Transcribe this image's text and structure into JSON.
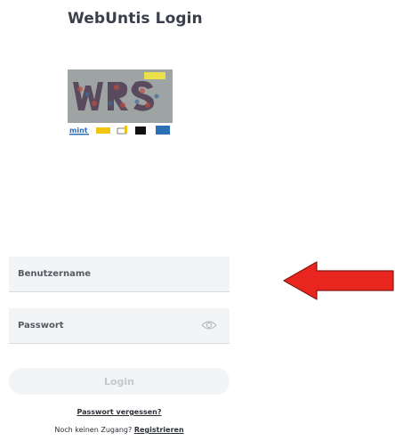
{
  "page": {
    "title": "WebUntis Login"
  },
  "logo": {
    "badge_text": "mint",
    "sponsor_text": "MINT",
    "colors": {
      "photo_bg": "#9aa0a4",
      "badge": "#e9e04a",
      "footer_blue": "#2c6fb5",
      "footer_yellow": "#f1c40f"
    }
  },
  "form": {
    "username_placeholder": "Benutzername",
    "password_placeholder": "Passwort",
    "password_toggle_icon": "eye-icon",
    "login_label": "Login"
  },
  "links": {
    "forgot_password": "Passwort vergessen?",
    "no_access_text": "Noch keinen Zugang?",
    "register": "Registrieren"
  },
  "annotation": {
    "arrow_icon": "left-arrow-icon",
    "arrow_color": "#e8261f"
  }
}
